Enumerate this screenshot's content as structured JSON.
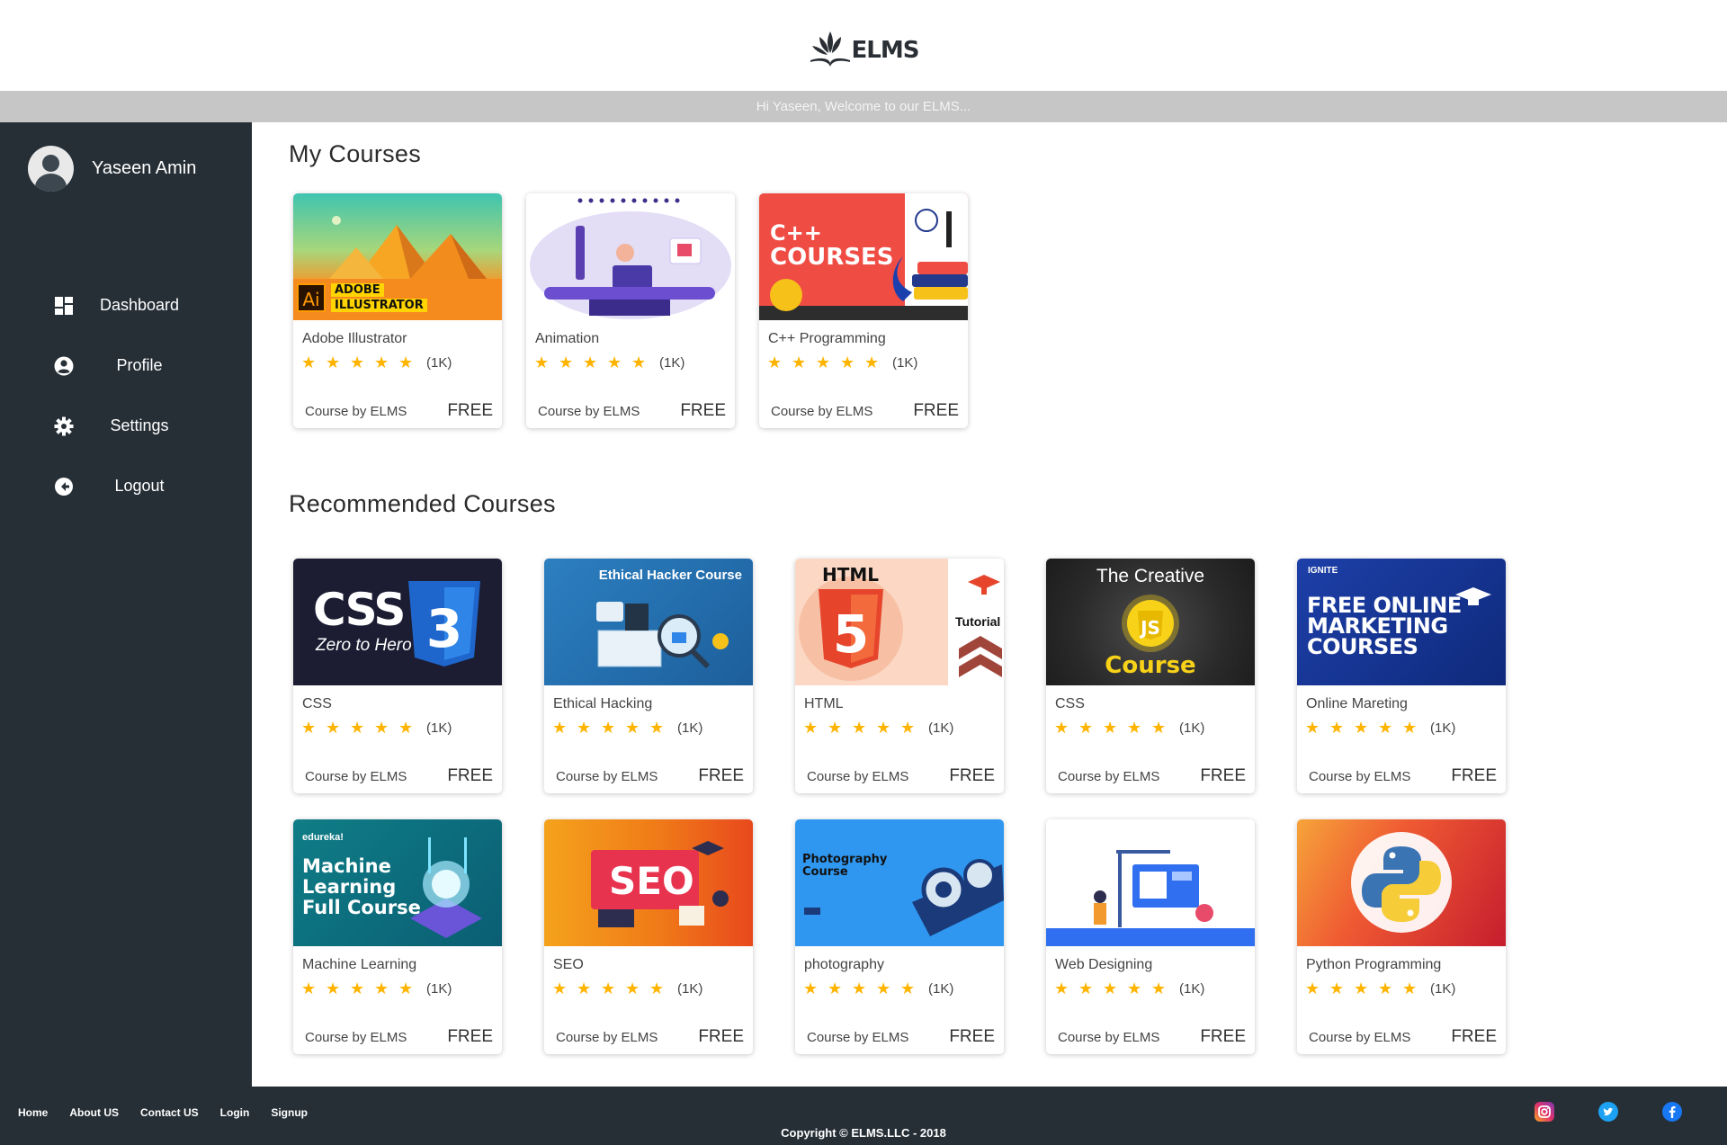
{
  "brand": {
    "name": "ELMS"
  },
  "welcome_text": "Hi Yaseen, Welcome to our ELMS...",
  "user": {
    "name": "Yaseen Amin"
  },
  "nav": [
    {
      "label": "Dashboard",
      "icon": "dashboard-icon"
    },
    {
      "label": "Profile",
      "icon": "user-circle-icon"
    },
    {
      "label": "Settings",
      "icon": "gear-icon"
    },
    {
      "label": "Logout",
      "icon": "logout-icon"
    }
  ],
  "sections": {
    "my_courses": "My Courses",
    "recommended": "Recommended Courses"
  },
  "my_courses": [
    {
      "title": "Adobe Illustrator",
      "rating": "(1K)",
      "byline": "Course by ELMS",
      "price": "FREE",
      "thumb_text": [
        "Ai",
        "ADOBE",
        "ILLUSTRATOR"
      ]
    },
    {
      "title": "Animation",
      "rating": "(1K)",
      "byline": "Course by ELMS",
      "price": "FREE"
    },
    {
      "title": "C++ Programming",
      "rating": "(1K)",
      "byline": "Course by ELMS",
      "price": "FREE",
      "thumb_text": [
        "C++",
        "COURSES"
      ]
    }
  ],
  "recommended": [
    {
      "title": "CSS",
      "rating": "(1K)",
      "byline": "Course by ELMS",
      "price": "FREE",
      "thumb_text": [
        "CSS",
        "Zero to Hero"
      ]
    },
    {
      "title": "Ethical Hacking",
      "rating": "(1K)",
      "byline": "Course by ELMS",
      "price": "FREE",
      "thumb_text": [
        "Ethical Hacker Course"
      ]
    },
    {
      "title": "HTML",
      "rating": "(1K)",
      "byline": "Course by ELMS",
      "price": "FREE",
      "thumb_text": [
        "HTML",
        "Tutorial"
      ]
    },
    {
      "title": "CSS",
      "rating": "(1K)",
      "byline": "Course by ELMS",
      "price": "FREE",
      "thumb_text": [
        "The Creative",
        "Course"
      ]
    },
    {
      "title": "Online Mareting",
      "rating": "(1K)",
      "byline": "Course by ELMS",
      "price": "FREE",
      "thumb_text": [
        "IGNITE",
        "FREE ONLINE",
        "MARKETING",
        "COURSES"
      ]
    },
    {
      "title": "Machine Learning",
      "rating": "(1K)",
      "byline": "Course by ELMS",
      "price": "FREE",
      "thumb_text": [
        "edureka!",
        "Machine",
        "Learning",
        "Full Course"
      ]
    },
    {
      "title": "SEO",
      "rating": "(1K)",
      "byline": "Course by ELMS",
      "price": "FREE",
      "thumb_text": [
        "SEO"
      ]
    },
    {
      "title": "photography",
      "rating": "(1K)",
      "byline": "Course by ELMS",
      "price": "FREE",
      "thumb_text": [
        "Photography",
        "Course"
      ]
    },
    {
      "title": "Web Designing",
      "rating": "(1K)",
      "byline": "Course by ELMS",
      "price": "FREE"
    },
    {
      "title": "Python Programming",
      "rating": "(1K)",
      "byline": "Course by ELMS",
      "price": "FREE"
    }
  ],
  "footer": {
    "links": [
      "Home",
      "About US",
      "Contact US",
      "Login",
      "Signup"
    ],
    "copyright": "Copyright © ELMS.LLC - 2018",
    "social": [
      "instagram-icon",
      "twitter-icon",
      "facebook-icon"
    ]
  },
  "colors": {
    "sidebar": "#262f36",
    "star": "#ffb400",
    "welcome_bar": "#c6c6c6"
  }
}
